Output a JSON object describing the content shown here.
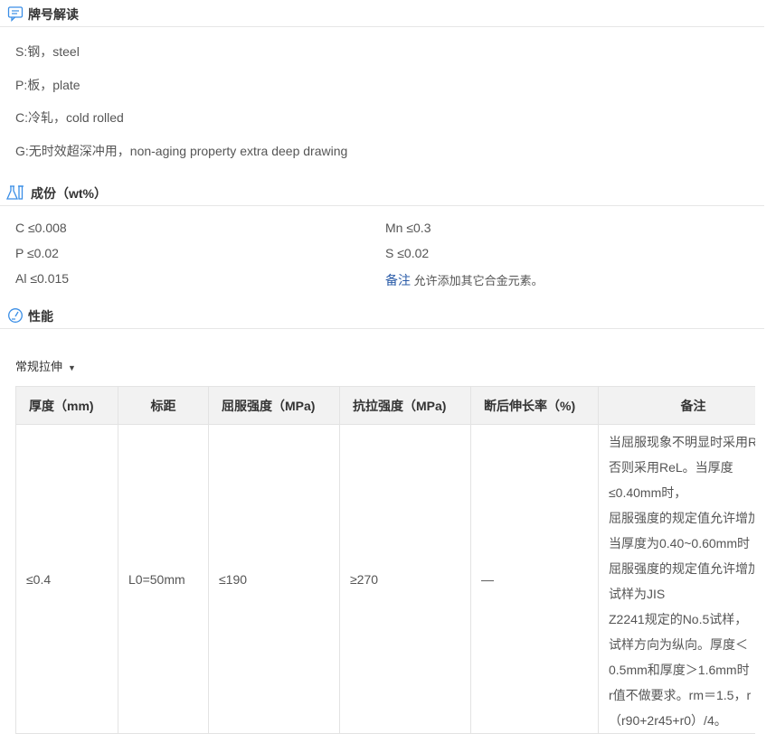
{
  "designation": {
    "title": "牌号解读",
    "lines": [
      "S:钢，steel",
      "P:板，plate",
      "C:冷轧，cold rolled",
      "G:无时效超深冲用，non-aging property extra deep drawing"
    ]
  },
  "composition": {
    "title": "成份（wt%）",
    "left": [
      "C ≤0.008",
      "P ≤0.02",
      "Al ≤0.015"
    ],
    "right": [
      "Mn ≤0.3",
      "S ≤0.02"
    ],
    "note_label": "备注",
    "note_text": " 允许添加其它合金元素。"
  },
  "performance": {
    "title": "性能",
    "dropdown_label": "常规拉伸",
    "table": {
      "headers": [
        "厚度（mm)",
        "标距",
        "屈服强度（MPa)",
        "抗拉强度（MPa)",
        "断后伸长率（%)",
        "备注"
      ],
      "row": [
        "≤0.4",
        "L0=50mm",
        "≤190",
        "≥270",
        "—"
      ],
      "note_lines": [
        "当屈服现象不明显时采用R",
        "否则采用ReL。当厚度",
        "≤0.40mm时，",
        "屈服强度的规定值允许增加",
        "当厚度为0.40~0.60mm时",
        "屈服强度的规定值允许增加",
        "试样为JIS",
        "Z2241规定的No.5试样，",
        "试样方向为纵向。厚度＜",
        "0.5mm和厚度＞1.6mm时",
        "r值不做要求。rm＝1.5，r",
        "（r90+2r45+r0）/4。"
      ]
    }
  }
}
